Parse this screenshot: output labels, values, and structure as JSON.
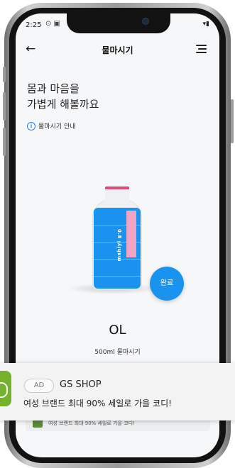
{
  "status": {
    "time": "2:25",
    "icons": "⊙ ▣",
    "right": "▾▮"
  },
  "nav": {
    "back_icon": "arrow-left-icon",
    "title": "물마시기",
    "menu_icon": "hamburger-menu-icon"
  },
  "heading": {
    "line1": "몸과 마음을",
    "line2": "가볍게 해볼까요"
  },
  "info": {
    "icon": "i",
    "label": "물마시기 안내"
  },
  "bottle": {
    "label": "0.8 ꞁʎᴉɥᴚɯ",
    "fill_level": 0.9
  },
  "done_button": {
    "label": "완료"
  },
  "amount": {
    "value": "OL",
    "subtitle": "500ml 물마시기"
  },
  "inner_banner": {
    "text": "여성 브랜드 최대 90% 세일로 가을 코디!"
  },
  "ad": {
    "badge": "AD",
    "brand": "GS SHOP",
    "text": "여성 브랜드 최대 90% 세일로 가을 코디!"
  },
  "colors": {
    "accent": "#1a93ee",
    "cap": "#e04b76",
    "label": "#f2a4c4",
    "ad_logo": "#73b22a"
  }
}
